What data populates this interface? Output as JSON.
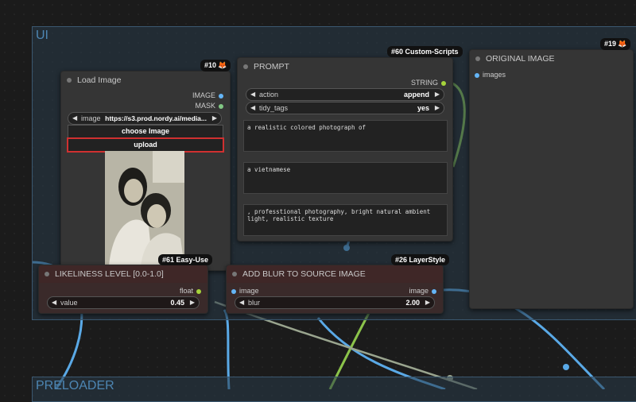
{
  "canvas": {
    "bg": "#1b1b1b"
  },
  "groups": {
    "ui": {
      "title": "UI"
    },
    "preloader": {
      "title": "PRELOADER"
    }
  },
  "colors": {
    "image_port": "#64b5f6",
    "mask_port": "#81c784",
    "string_port": "#a6d43b",
    "float_port": "#a6d43b",
    "highlight_border": "#d03030",
    "wire_blue": "#5aa9e6",
    "wire_green": "#8bc34a",
    "wire_gray": "#9aa58f"
  },
  "nodes": {
    "load_image": {
      "badge": "#10",
      "badge_icon": "fox-icon",
      "title": "Load Image",
      "outputs": [
        "IMAGE",
        "MASK"
      ],
      "image_widget": {
        "label": "image",
        "value": "https://s3.prod.nordy.ai/media..."
      },
      "choose_button": "choose Image",
      "upload_button": "upload"
    },
    "prompt": {
      "badge": "#60 Custom-Scripts",
      "title": "PROMPT",
      "output": "STRING",
      "action": {
        "label": "action",
        "value": "append"
      },
      "tidy_tags": {
        "label": "tidy_tags",
        "value": "yes"
      },
      "texts": [
        "a realistic colored photograph of",
        "a vietnamese",
        ", professtional photography, bright natural ambient light, realistic texture"
      ]
    },
    "original_image": {
      "badge": "#19",
      "badge_icon": "fox-icon",
      "title": "ORIGINAL IMAGE",
      "input": "images"
    },
    "likeliness": {
      "badge": "#61 Easy-Use",
      "title": "LIKELINESS LEVEL [0.0-1.0]",
      "output": "float",
      "widget": {
        "label": "value",
        "value": "0.45"
      }
    },
    "blur": {
      "badge": "#26 LayerStyle",
      "title": "ADD BLUR TO SOURCE IMAGE",
      "input": "image",
      "output": "image",
      "widget": {
        "label": "blur",
        "value": "2.00"
      }
    }
  }
}
